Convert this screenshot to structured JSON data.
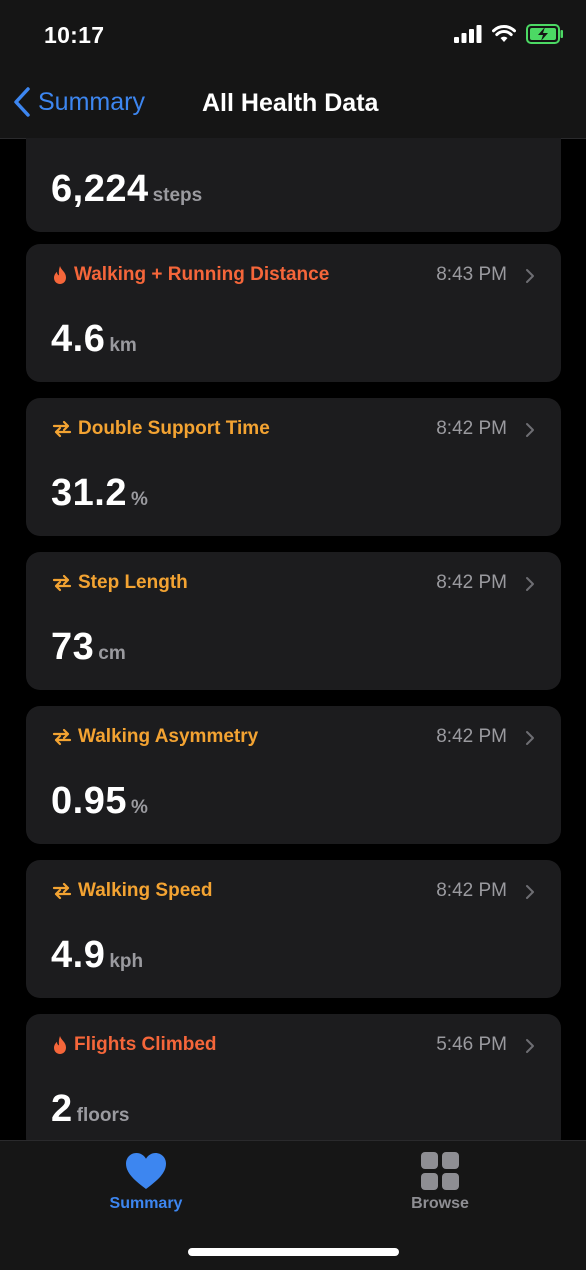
{
  "status_bar": {
    "time": "10:17",
    "icons": [
      "signal-icon",
      "wifi-icon",
      "battery-charging-icon"
    ]
  },
  "nav": {
    "back_label": "Summary",
    "title": "All Health Data"
  },
  "colors": {
    "accent_blue": "#3d86f0",
    "activity_orange": "#f5663a",
    "mobility_orange": "#f3a332",
    "card_bg": "#1c1c1e"
  },
  "cards": [
    {
      "label": "",
      "time": "",
      "value": "6,224",
      "unit": "steps",
      "icon": ""
    },
    {
      "label": "Walking + Running Distance",
      "time": "8:43 PM",
      "value": "4.6",
      "unit": "km",
      "icon": "flame-icon",
      "color": "#f5663a"
    },
    {
      "label": "Double Support Time",
      "time": "8:42 PM",
      "value": "31.2",
      "unit": "%",
      "icon": "mobility-arrows-icon",
      "color": "#f3a332"
    },
    {
      "label": "Step Length",
      "time": "8:42 PM",
      "value": "73",
      "unit": "cm",
      "icon": "mobility-arrows-icon",
      "color": "#f3a332"
    },
    {
      "label": "Walking Asymmetry",
      "time": "8:42 PM",
      "value": "0.95",
      "unit": "%",
      "icon": "mobility-arrows-icon",
      "color": "#f3a332"
    },
    {
      "label": "Walking Speed",
      "time": "8:42 PM",
      "value": "4.9",
      "unit": "kph",
      "icon": "mobility-arrows-icon",
      "color": "#f3a332"
    },
    {
      "label": "Flights Climbed",
      "time": "5:46 PM",
      "value": "2",
      "unit": "floors",
      "icon": "flame-icon",
      "color": "#f5663a"
    }
  ],
  "tabs": [
    {
      "label": "Summary",
      "icon": "heart-icon",
      "active": true
    },
    {
      "label": "Browse",
      "icon": "grid-icon",
      "active": false
    }
  ]
}
